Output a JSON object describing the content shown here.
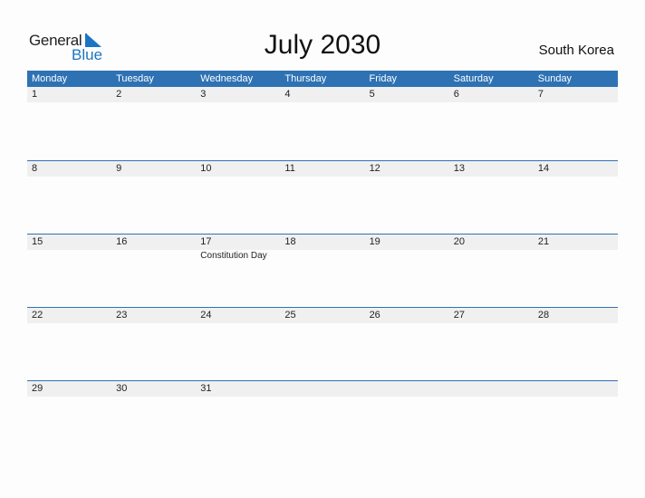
{
  "logo": {
    "word1": "General",
    "word2": "Blue"
  },
  "title": "July 2030",
  "country": "South Korea",
  "colors": {
    "accent": "#2e72b4",
    "strip": "#f0f0f0",
    "logo_blue": "#1a75c2"
  },
  "weekdays": [
    "Monday",
    "Tuesday",
    "Wednesday",
    "Thursday",
    "Friday",
    "Saturday",
    "Sunday"
  ],
  "weeks": [
    [
      {
        "d": "1"
      },
      {
        "d": "2"
      },
      {
        "d": "3"
      },
      {
        "d": "4"
      },
      {
        "d": "5"
      },
      {
        "d": "6"
      },
      {
        "d": "7"
      }
    ],
    [
      {
        "d": "8"
      },
      {
        "d": "9"
      },
      {
        "d": "10"
      },
      {
        "d": "11"
      },
      {
        "d": "12"
      },
      {
        "d": "13"
      },
      {
        "d": "14"
      }
    ],
    [
      {
        "d": "15"
      },
      {
        "d": "16"
      },
      {
        "d": "17",
        "holiday": "Constitution Day"
      },
      {
        "d": "18"
      },
      {
        "d": "19"
      },
      {
        "d": "20"
      },
      {
        "d": "21"
      }
    ],
    [
      {
        "d": "22"
      },
      {
        "d": "23"
      },
      {
        "d": "24"
      },
      {
        "d": "25"
      },
      {
        "d": "26"
      },
      {
        "d": "27"
      },
      {
        "d": "28"
      }
    ],
    [
      {
        "d": "29"
      },
      {
        "d": "30"
      },
      {
        "d": "31"
      },
      {
        "d": ""
      },
      {
        "d": ""
      },
      {
        "d": ""
      },
      {
        "d": ""
      }
    ]
  ]
}
